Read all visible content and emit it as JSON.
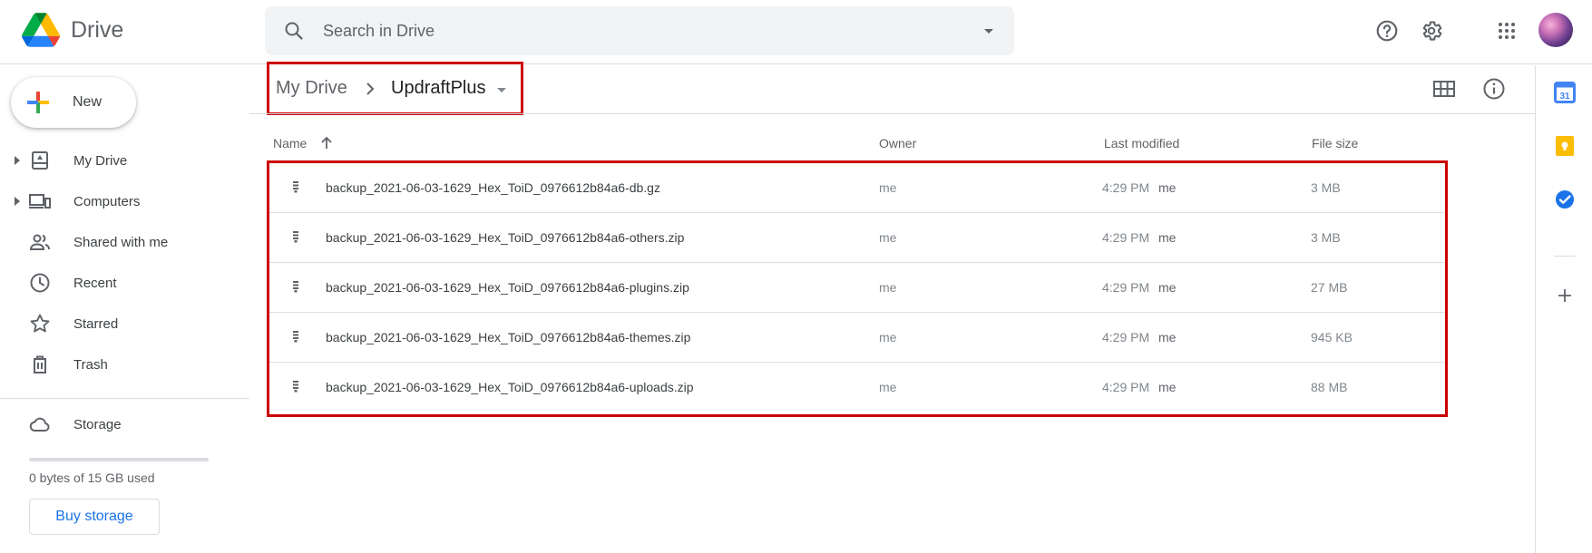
{
  "app": {
    "name": "Drive"
  },
  "search": {
    "placeholder": "Search in Drive"
  },
  "sidebar": {
    "new_label": "New",
    "items": [
      {
        "label": "My Drive",
        "icon": "my-drive-icon",
        "expandable": true
      },
      {
        "label": "Computers",
        "icon": "computers-icon",
        "expandable": true
      },
      {
        "label": "Shared with me",
        "icon": "shared-icon",
        "expandable": false
      },
      {
        "label": "Recent",
        "icon": "clock-icon",
        "expandable": false
      },
      {
        "label": "Starred",
        "icon": "star-icon",
        "expandable": false
      },
      {
        "label": "Trash",
        "icon": "trash-icon",
        "expandable": false
      }
    ],
    "storage": {
      "label": "Storage",
      "used_text": "0 bytes of 15 GB used",
      "used_fraction": 0,
      "buy_label": "Buy storage"
    }
  },
  "breadcrumb": {
    "root": "My Drive",
    "current": "UpdraftPlus"
  },
  "table": {
    "columns": {
      "name": "Name",
      "owner": "Owner",
      "modified": "Last modified",
      "size": "File size"
    },
    "rows": [
      {
        "name": "backup_2021-06-03-1629_Hex_ToiD_0976612b84a6-db.gz",
        "owner": "me",
        "modified_time": "4:29 PM",
        "modified_by": "me",
        "size": "3 MB"
      },
      {
        "name": "backup_2021-06-03-1629_Hex_ToiD_0976612b84a6-others.zip",
        "owner": "me",
        "modified_time": "4:29 PM",
        "modified_by": "me",
        "size": "3 MB"
      },
      {
        "name": "backup_2021-06-03-1629_Hex_ToiD_0976612b84a6-plugins.zip",
        "owner": "me",
        "modified_time": "4:29 PM",
        "modified_by": "me",
        "size": "27 MB"
      },
      {
        "name": "backup_2021-06-03-1629_Hex_ToiD_0976612b84a6-themes.zip",
        "owner": "me",
        "modified_time": "4:29 PM",
        "modified_by": "me",
        "size": "945 KB"
      },
      {
        "name": "backup_2021-06-03-1629_Hex_ToiD_0976612b84a6-uploads.zip",
        "owner": "me",
        "modified_time": "4:29 PM",
        "modified_by": "me",
        "size": "88 MB"
      }
    ]
  },
  "side_panel": {
    "calendar_day": "31",
    "apps": [
      "calendar-icon",
      "keep-icon",
      "tasks-icon",
      "add-icon"
    ]
  },
  "colors": {
    "accent": "#1a73e8",
    "highlight_box": "#cc0000",
    "text": "#3c4043",
    "muted": "#5f6368"
  }
}
